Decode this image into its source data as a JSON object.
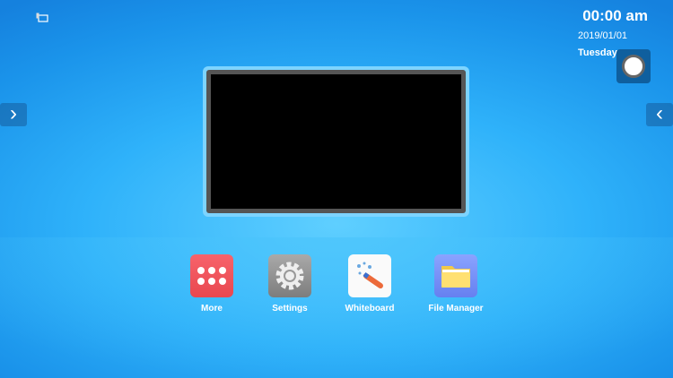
{
  "status": {
    "time": "00:00 am",
    "date": "2019/01/01",
    "day": "Tuesday"
  },
  "apps": [
    {
      "label": "More"
    },
    {
      "label": "Settings"
    },
    {
      "label": "Whiteboard"
    },
    {
      "label": "File Manager"
    }
  ]
}
